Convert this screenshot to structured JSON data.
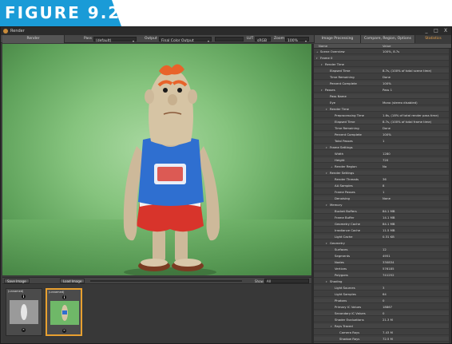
{
  "figure": {
    "label": "FIGURE 9.23",
    "color": "#1a9bd7"
  },
  "window": {
    "title": "Render",
    "controls": [
      "_",
      "□",
      "X"
    ]
  },
  "toolbar": {
    "render_tab": "Render",
    "pass_label": "Pass",
    "pass_value": "(default)",
    "output_label": "Output",
    "output_value": "Final Color Output",
    "lut_label": "LUT",
    "lut_value": "sRGB",
    "zoom_label": "Zoom",
    "zoom_value": "100%",
    "tabs": [
      "Image Processing",
      "Compare, Region, Options",
      "Statistics"
    ],
    "active_tab": "Statistics",
    "accent": "#e8a24a"
  },
  "image_bar": {
    "save_label": "Save Image",
    "load_label": "Load Image",
    "show_label": "Show",
    "show_value": "All"
  },
  "thumbnails": [
    {
      "label": "(unnamed)",
      "active": false
    },
    {
      "label": "(unnamed)",
      "active": true
    }
  ],
  "stats": {
    "headers": {
      "name": "Name",
      "value": "Value"
    },
    "rows": [
      {
        "name": "Scene Overview",
        "value": "100%, 8.7s",
        "depth": 0,
        "tri": "+"
      },
      {
        "name": "Frame 0",
        "value": "",
        "depth": 0,
        "tri": "▾"
      },
      {
        "name": "Render Time",
        "value": "",
        "depth": 1,
        "tri": "▾"
      },
      {
        "name": "Elapsed Time",
        "value": "8.7s, (100% of total scene time)",
        "depth": 2,
        "tri": ""
      },
      {
        "name": "Time Remaining",
        "value": "Done",
        "depth": 2,
        "tri": ""
      },
      {
        "name": "Percent Complete",
        "value": "100%",
        "depth": 2,
        "tri": ""
      },
      {
        "name": "Passes",
        "value": "Pass 1",
        "depth": 1,
        "tri": "▾"
      },
      {
        "name": "Pass Name",
        "value": "",
        "depth": 2,
        "tri": ""
      },
      {
        "name": "Eye",
        "value": "Mono (stereo disabled)",
        "depth": 2,
        "tri": ""
      },
      {
        "name": "Render Time",
        "value": "",
        "depth": 2,
        "tri": "▾"
      },
      {
        "name": "Preprocessing Time",
        "value": "1.6s, (18% of total render pass time)",
        "depth": 3,
        "tri": ""
      },
      {
        "name": "Elapsed Time",
        "value": "8.7s, (100% of total frame time)",
        "depth": 3,
        "tri": ""
      },
      {
        "name": "Time Remaining",
        "value": "Done",
        "depth": 3,
        "tri": ""
      },
      {
        "name": "Percent Complete",
        "value": "100%",
        "depth": 3,
        "tri": ""
      },
      {
        "name": "Total Passes",
        "value": "1",
        "depth": 3,
        "tri": ""
      },
      {
        "name": "Frame Settings",
        "value": "",
        "depth": 2,
        "tri": "▾"
      },
      {
        "name": "Width",
        "value": "1280",
        "depth": 3,
        "tri": ""
      },
      {
        "name": "Height",
        "value": "720",
        "depth": 3,
        "tri": ""
      },
      {
        "name": "Render Region",
        "value": "No",
        "depth": 3,
        "tri": "+"
      },
      {
        "name": "Render Settings",
        "value": "",
        "depth": 2,
        "tri": "▾"
      },
      {
        "name": "Render Threads",
        "value": "36",
        "depth": 3,
        "tri": ""
      },
      {
        "name": "AA Samples",
        "value": "8",
        "depth": 3,
        "tri": ""
      },
      {
        "name": "Frame Passes",
        "value": "1",
        "depth": 3,
        "tri": ""
      },
      {
        "name": "Denoising",
        "value": "None",
        "depth": 3,
        "tri": ""
      },
      {
        "name": "Memory",
        "value": "",
        "depth": 2,
        "tri": "▾"
      },
      {
        "name": "Bucket Buffers",
        "value": "84.1 MB",
        "depth": 3,
        "tri": ""
      },
      {
        "name": "Frame Buffer",
        "value": "14.1 MB",
        "depth": 3,
        "tri": ""
      },
      {
        "name": "Geometry Cache",
        "value": "84.1 MB",
        "depth": 3,
        "tri": ""
      },
      {
        "name": "Irradiance Cache",
        "value": "11.5 MB",
        "depth": 3,
        "tri": ""
      },
      {
        "name": "Light Cache",
        "value": "0.31 KB",
        "depth": 3,
        "tri": ""
      },
      {
        "name": "Geometry",
        "value": "",
        "depth": 2,
        "tri": "▾"
      },
      {
        "name": "Surfaces",
        "value": "12",
        "depth": 3,
        "tri": ""
      },
      {
        "name": "Segments",
        "value": "4951",
        "depth": 3,
        "tri": ""
      },
      {
        "name": "Nodes",
        "value": "330834",
        "depth": 3,
        "tri": ""
      },
      {
        "name": "Vertices",
        "value": "576185",
        "depth": 3,
        "tri": ""
      },
      {
        "name": "Polygons",
        "value": "741252",
        "depth": 3,
        "tri": ""
      },
      {
        "name": "Shading",
        "value": "",
        "depth": 2,
        "tri": "▾"
      },
      {
        "name": "Light Sources",
        "value": "3",
        "depth": 3,
        "tri": ""
      },
      {
        "name": "Light Samples",
        "value": "64",
        "depth": 3,
        "tri": ""
      },
      {
        "name": "Photons",
        "value": "0",
        "depth": 3,
        "tri": ""
      },
      {
        "name": "Primary IC Values",
        "value": "18867",
        "depth": 3,
        "tri": ""
      },
      {
        "name": "Secondary IC Values",
        "value": "0",
        "depth": 3,
        "tri": ""
      },
      {
        "name": "Shader Evaluations",
        "value": "21.3 M",
        "depth": 3,
        "tri": ""
      },
      {
        "name": "Rays Traced",
        "value": "",
        "depth": 3,
        "tri": "▾"
      },
      {
        "name": "Camera Rays",
        "value": "7.43 M",
        "depth": 4,
        "tri": ""
      },
      {
        "name": "Shadow Rays",
        "value": "72.5 M",
        "depth": 4,
        "tri": ""
      },
      {
        "name": "Indirect Rays",
        "value": "6.93 M",
        "depth": 4,
        "tri": ""
      }
    ]
  }
}
